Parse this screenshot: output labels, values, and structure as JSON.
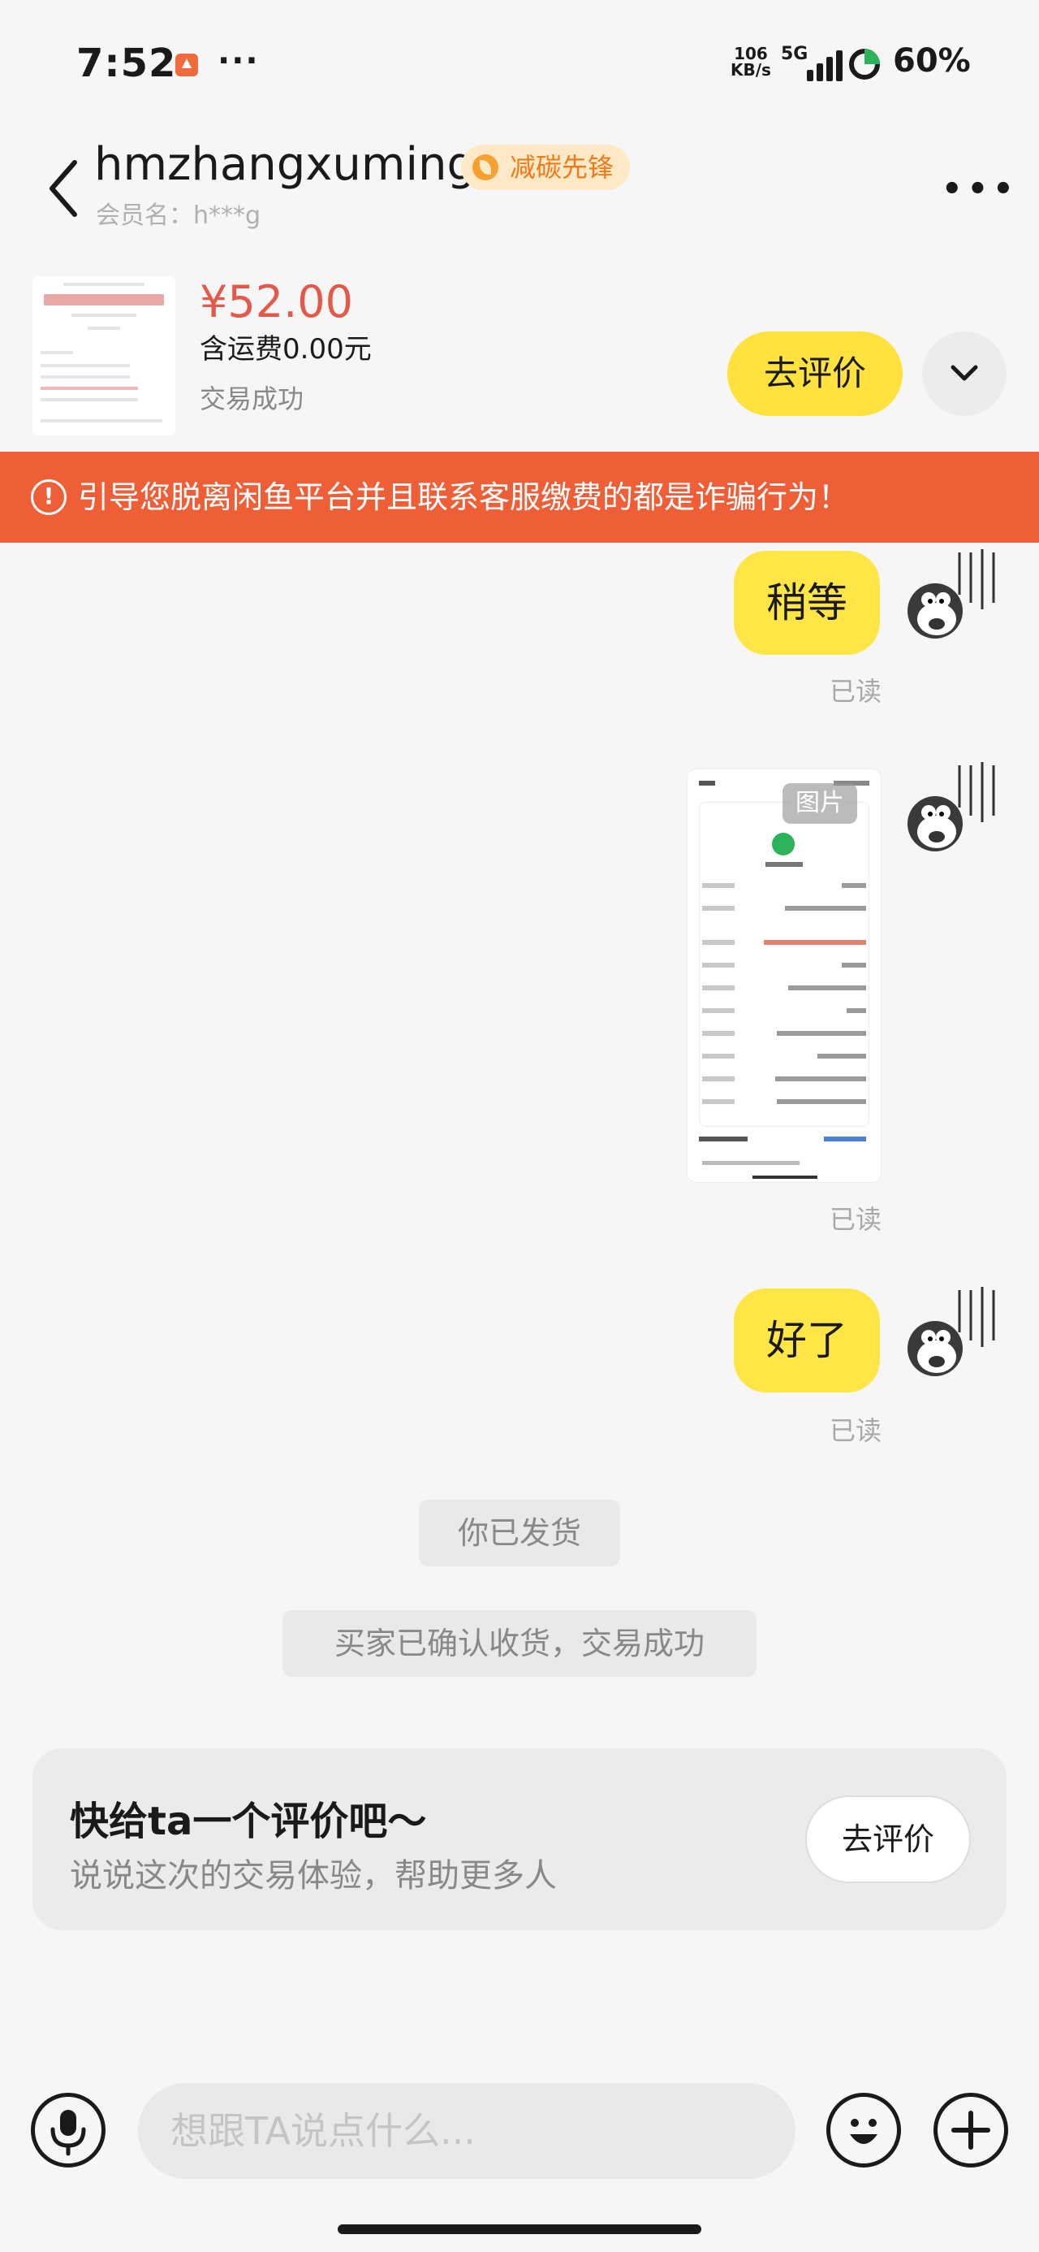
{
  "status_bar": {
    "time": "7:52",
    "net_speed_top": "106",
    "net_speed_bottom": "KB/s",
    "network": "5G",
    "battery": "60%"
  },
  "header": {
    "username": "hmzhangxuming",
    "badge": "减碳先锋",
    "member_name": "会员名：h***g"
  },
  "product": {
    "price": "¥52.00",
    "shipping": "含运费0.00元",
    "status": "交易成功",
    "review_button": "去评价"
  },
  "warning": {
    "text": "引导您脱离闲鱼平台并且联系客服缴费的都是诈骗行为！"
  },
  "messages": [
    {
      "text": "稍等",
      "read": "已读"
    },
    {
      "image_label": "图片",
      "read": "已读"
    },
    {
      "text": "好了",
      "read": "已读"
    }
  ],
  "system_messages": [
    "你已发货",
    "买家已确认收货，交易成功"
  ],
  "review_card": {
    "title": "快给ta一个评价吧～",
    "subtitle": "说说这次的交易体验，帮助更多人",
    "button": "去评价"
  },
  "input": {
    "placeholder": "想跟TA说点什么..."
  },
  "colors": {
    "accent_yellow": "#ffe646",
    "warning_orange": "#ee5f38",
    "price_red": "#e35a4b"
  }
}
